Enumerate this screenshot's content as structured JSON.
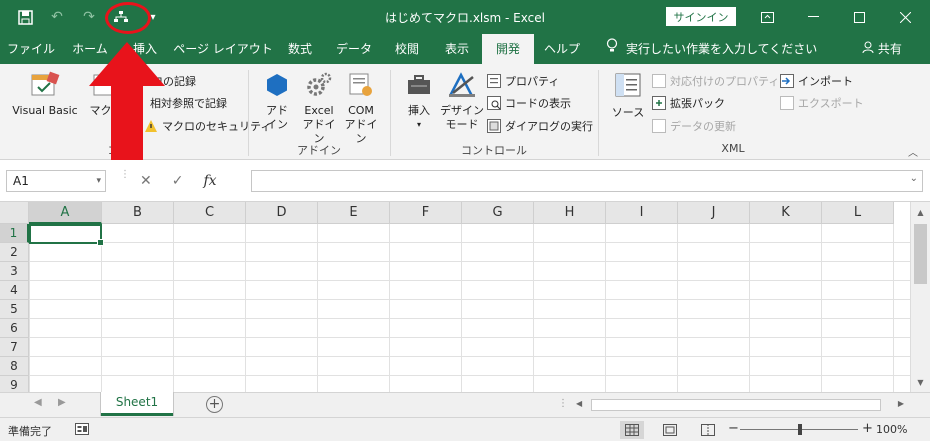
{
  "window": {
    "title": "はじめてマクロ.xlsm  -  Excel",
    "signin_label": "サインイン"
  },
  "qat": [
    "save-icon",
    "undo-icon",
    "redo-icon",
    "macro-icon",
    "customize-icon"
  ],
  "tabs": [
    {
      "label": "ファイル"
    },
    {
      "label": "ホーム"
    },
    {
      "label": "挿入"
    },
    {
      "label": "ページ レイアウト"
    },
    {
      "label": "数式"
    },
    {
      "label": "データ"
    },
    {
      "label": "校閲"
    },
    {
      "label": "表示"
    },
    {
      "label": "開発",
      "active": true
    },
    {
      "label": "ヘルプ"
    }
  ],
  "tell_me": "実行したい作業を入力してください",
  "share": "共有",
  "ribbon": {
    "code": {
      "label": "コード",
      "visual_basic": "Visual Basic",
      "macro": "マクロ",
      "record": "ロの記録",
      "relative": "相対参照で記録",
      "security": "マクロのセキュリティ"
    },
    "addins": {
      "label": "アドイン",
      "addin_1": "アド",
      "addin_2": "イン",
      "excel_1": "Excel",
      "excel_2": "アドイン",
      "com_1": "COM",
      "com_2": "アドイン"
    },
    "controls": {
      "label": "コントロール",
      "insert": "挿入",
      "design_1": "デザイン",
      "design_2": "モード",
      "properties": "プロパティ",
      "view_code": "コードの表示",
      "run_dialog": "ダイアログの実行"
    },
    "xml": {
      "label": "XML",
      "source": "ソース",
      "map_props": "対応付けのプロパティ",
      "expansion": "拡張パック",
      "refresh": "データの更新",
      "import": "インポート",
      "export": "エクスポート"
    }
  },
  "formula_bar": {
    "name_box": "A1",
    "cancel": "✕",
    "enter": "✓",
    "fx": "fx",
    "value": ""
  },
  "grid": {
    "columns": [
      "A",
      "B",
      "C",
      "D",
      "E",
      "F",
      "G",
      "H",
      "I",
      "J",
      "K",
      "L"
    ],
    "rows": [
      "1",
      "2",
      "3",
      "4",
      "5",
      "6",
      "7",
      "8",
      "9"
    ],
    "active_cell": "A1"
  },
  "sheets": [
    {
      "name": "Sheet1",
      "active": true
    }
  ],
  "status": {
    "ready": "準備完了",
    "zoom": "100%",
    "minus": "−",
    "plus": "+"
  },
  "colors": {
    "brand": "#217346",
    "annotation": "#e8131b"
  }
}
